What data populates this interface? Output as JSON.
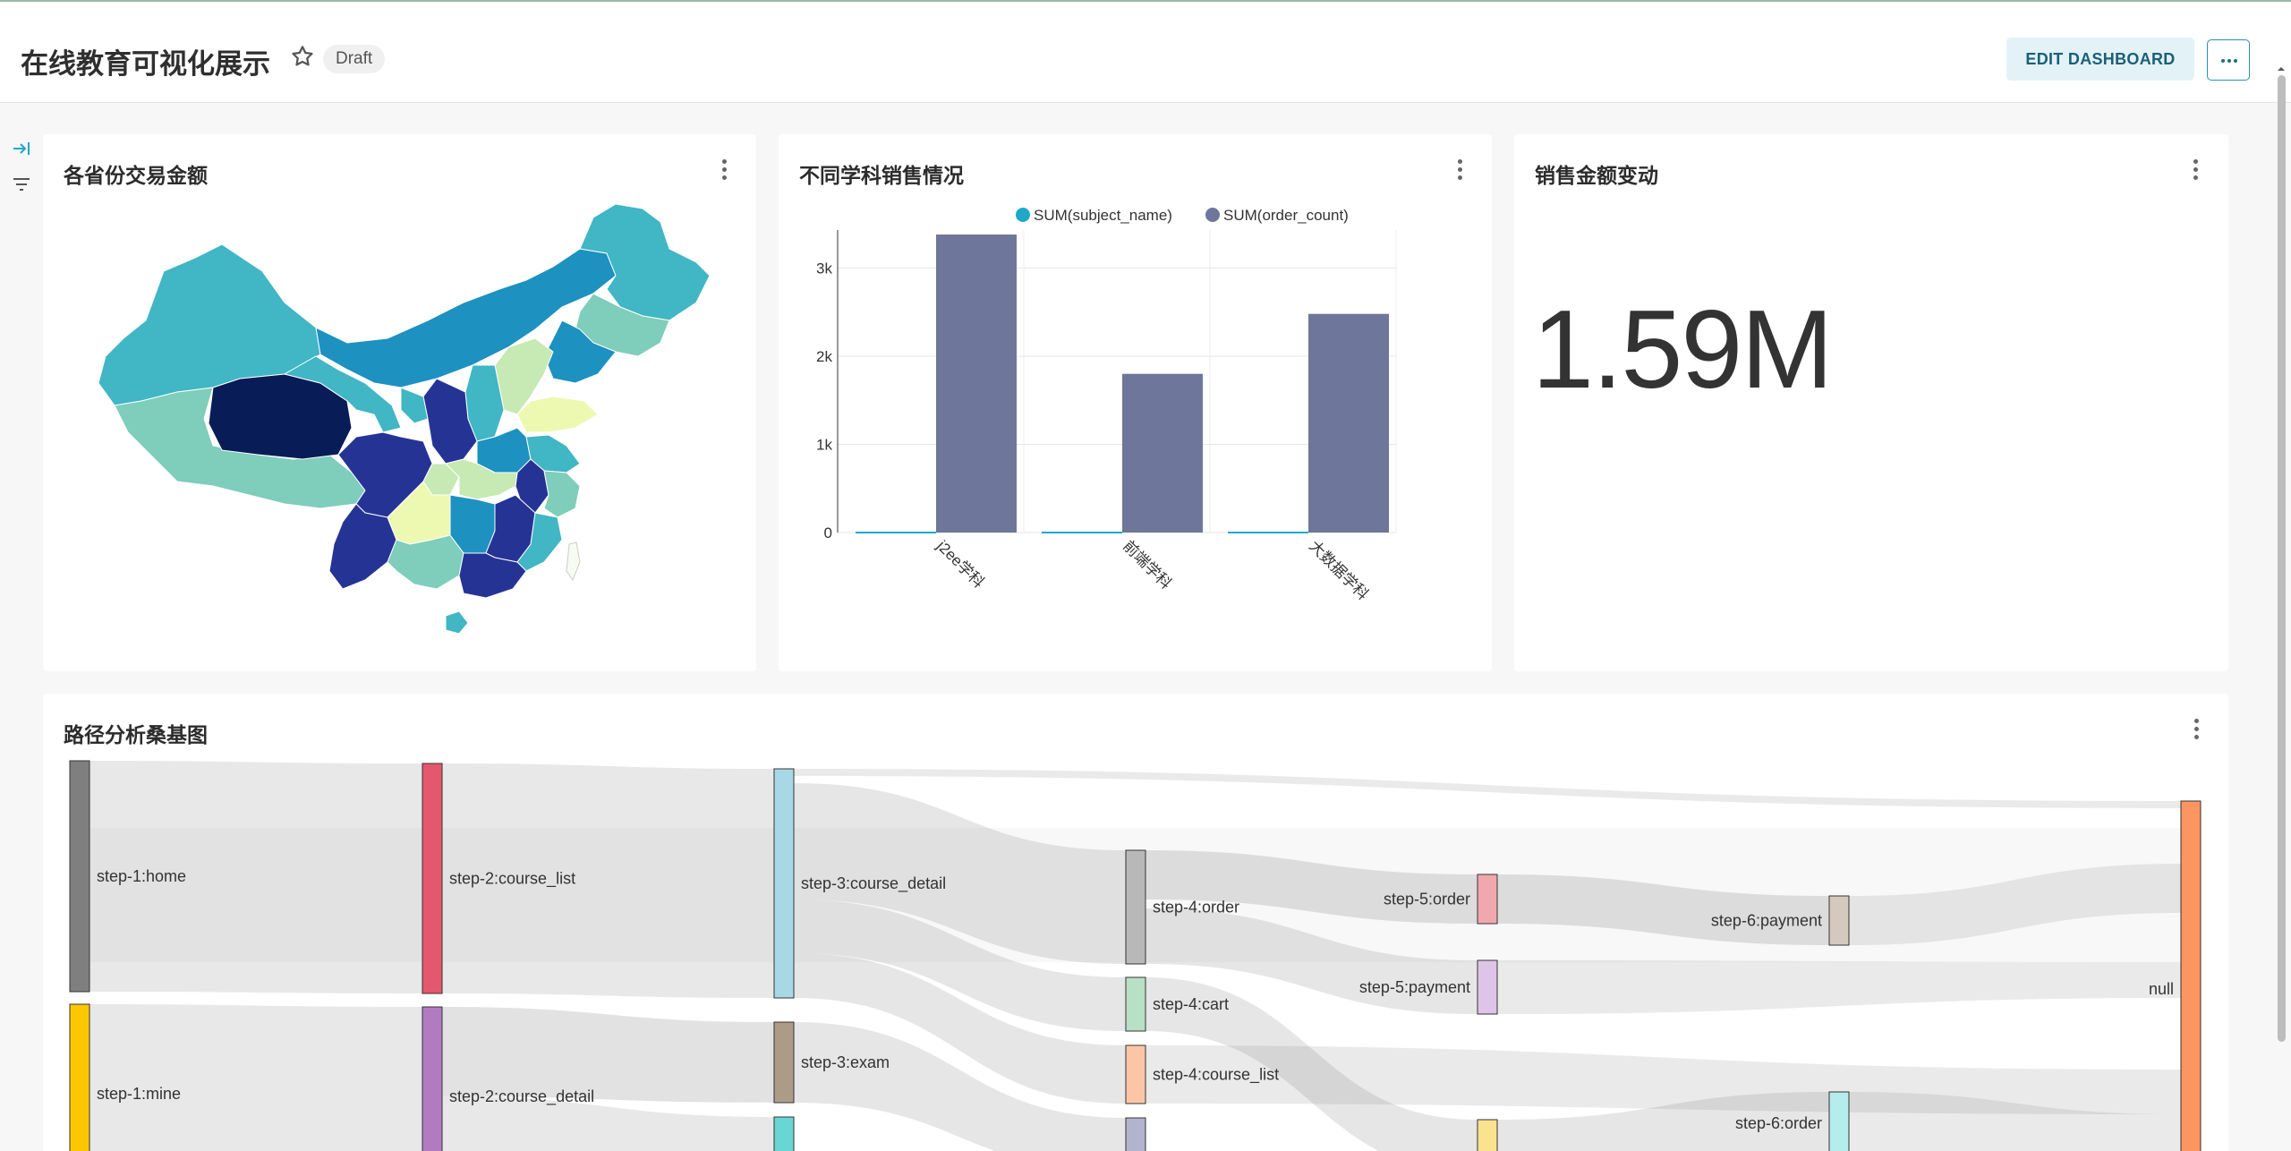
{
  "dashboard": {
    "title": "在线教育可视化展示",
    "status_badge": "Draft",
    "edit_button": "EDIT DASHBOARD"
  },
  "icons": {
    "favorite": "star-icon",
    "more": "ellipsis-icon",
    "expand_filters": "expand-arrow-icon",
    "filter": "filter-icon",
    "card_menu": "kebab-icon"
  },
  "colors": {
    "accent": "#1b5f78",
    "bar_series": "#6e769b",
    "subject_series": "#1fa8c9"
  },
  "charts": {
    "map": {
      "title": "各省份交易金额"
    },
    "bar": {
      "title": "不同学科销售情况"
    },
    "bignum": {
      "title": "销售金额变动",
      "value": "1.59M"
    },
    "sankey": {
      "title": "路径分析桑基图"
    }
  },
  "chart_data": [
    {
      "type": "map",
      "title": "各省份交易金额",
      "region": "China provinces",
      "color_scale": "YlGnBu"
    },
    {
      "type": "bar",
      "title": "不同学科销售情况",
      "categories": [
        "j2ee学科",
        "前端学科",
        "大数据学科"
      ],
      "series": [
        {
          "name": "SUM(subject_name)",
          "values": [
            0,
            0,
            0
          ],
          "color": "#1fa8c9"
        },
        {
          "name": "SUM(order_count)",
          "values": [
            3380,
            1800,
            2480
          ],
          "color": "#6e769b"
        }
      ],
      "yticks": [
        "0",
        "1k",
        "2k",
        "3k"
      ],
      "ylim": [
        0,
        3350
      ],
      "legend": "top",
      "grid": true
    },
    {
      "type": "big_number",
      "title": "销售金额变动",
      "value": "1.59M"
    },
    {
      "type": "sankey",
      "title": "路径分析桑基图",
      "nodes": [
        "step-1:home",
        "step-1:mine",
        "step-2:course_list",
        "step-2:course_detail",
        "step-3:course_detail",
        "step-3:exam",
        "step-4:order",
        "step-4:cart",
        "step-4:course_list",
        "step-5:order",
        "step-5:payment",
        "step-6:payment",
        "step-6:order",
        "null"
      ]
    }
  ]
}
